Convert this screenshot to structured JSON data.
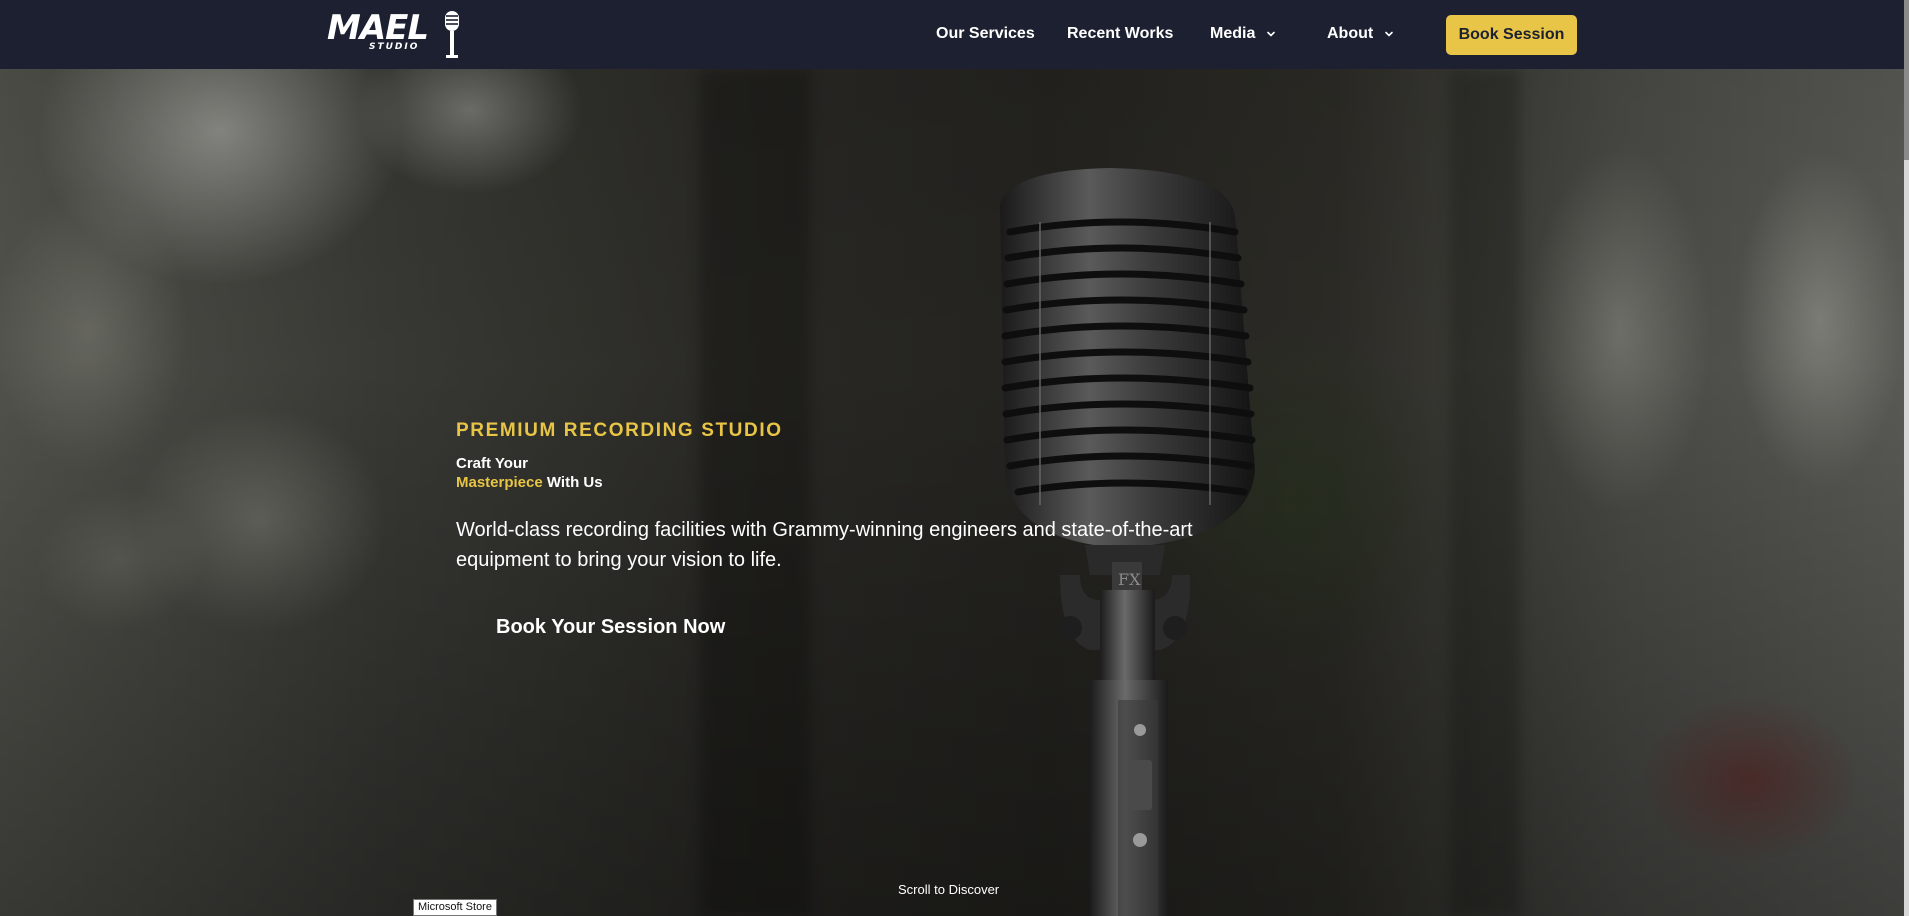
{
  "brand": {
    "wordmark": "MAEL",
    "subtitle": "STUDIO",
    "logo_icon": "microphone-icon"
  },
  "nav": {
    "items": [
      {
        "label": "Our Services",
        "has_dropdown": false
      },
      {
        "label": "Recent Works",
        "has_dropdown": false
      },
      {
        "label": "Media",
        "has_dropdown": true
      },
      {
        "label": "About",
        "has_dropdown": true
      }
    ],
    "cta_label": "Book Session"
  },
  "hero": {
    "eyebrow": "PREMIUM RECORDING STUDIO",
    "headline_line1": "Craft Your",
    "headline_accent": "Masterpiece",
    "headline_rest": " With Us",
    "description": "World-class recording facilities with Grammy-winning engineers and state-of-the-art equipment to bring your vision to life.",
    "cta_label": "Book Your Session Now",
    "scroll_hint": "Scroll to Discover"
  },
  "tooltip": {
    "text": "Microsoft Store"
  },
  "colors": {
    "accent": "#e8c547",
    "navbar": "#1c2030",
    "text": "#ffffff"
  }
}
